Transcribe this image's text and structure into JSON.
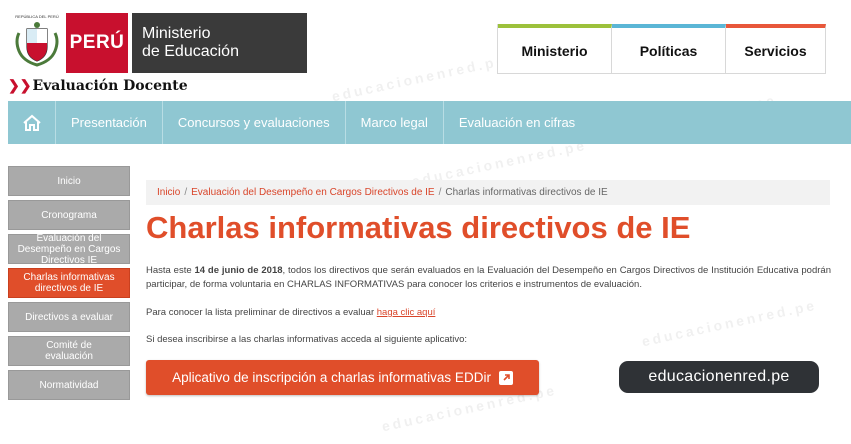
{
  "header": {
    "seal_text": "REPÚBLICA DEL PERÚ",
    "country": "PERÚ",
    "ministry_line1": "Ministerio",
    "ministry_line2": "de Educación",
    "subsite": "Evaluación Docente",
    "top_nav": [
      "Ministerio",
      "Políticas",
      "Servicios"
    ],
    "colors": {
      "red": "#c8102e",
      "green": "#9cc13b",
      "blue": "#5bb6d6",
      "orange": "#e8573a"
    }
  },
  "main_nav": {
    "home_icon": "home-icon",
    "items": [
      "Presentación",
      "Concursos y evaluaciones",
      "Marco legal",
      "Evaluación en cifras"
    ]
  },
  "sidebar": {
    "items": [
      {
        "label": "Inicio",
        "active": false
      },
      {
        "label": "Cronograma",
        "active": false
      },
      {
        "label": "Evaluación del Desempeño en Cargos Directivos IE",
        "active": false
      },
      {
        "label": "Charlas informativas directivos de IE",
        "active": true
      },
      {
        "label": "Directivos a evaluar",
        "active": false
      },
      {
        "label": "Comité de evaluación",
        "active": false
      },
      {
        "label": "Normatividad",
        "active": false
      }
    ]
  },
  "breadcrumb": {
    "items": [
      "Inicio",
      "Evaluación del Desempeño en Cargos Directivos de IE",
      "Charlas informativas directivos de IE"
    ]
  },
  "content": {
    "title": "Charlas informativas directivos de IE",
    "p1_pre": "Hasta este ",
    "p1_bold": "14 de junio de 2018",
    "p1_post": ", todos los directivos que serán evaluados en la Evaluación del Desempeño en Cargos Directivos de Institución Educativa podrán participar, de forma voluntaria en CHARLAS INFORMATIVAS para conocer los criterios e instrumentos de evaluación.",
    "p2_pre": "Para conocer la lista preliminar de directivos a evaluar ",
    "p2_link": "haga clic aquí",
    "p3": "Si desea inscribirse a las charlas informativas acceda al siguiente aplicativo:",
    "button_label": "Aplicativo de inscripción a charlas informativas EDDir",
    "button_icon": "external-link-icon",
    "accent": "#e04e2a"
  },
  "watermark": {
    "text": "educacionenred.pe"
  }
}
